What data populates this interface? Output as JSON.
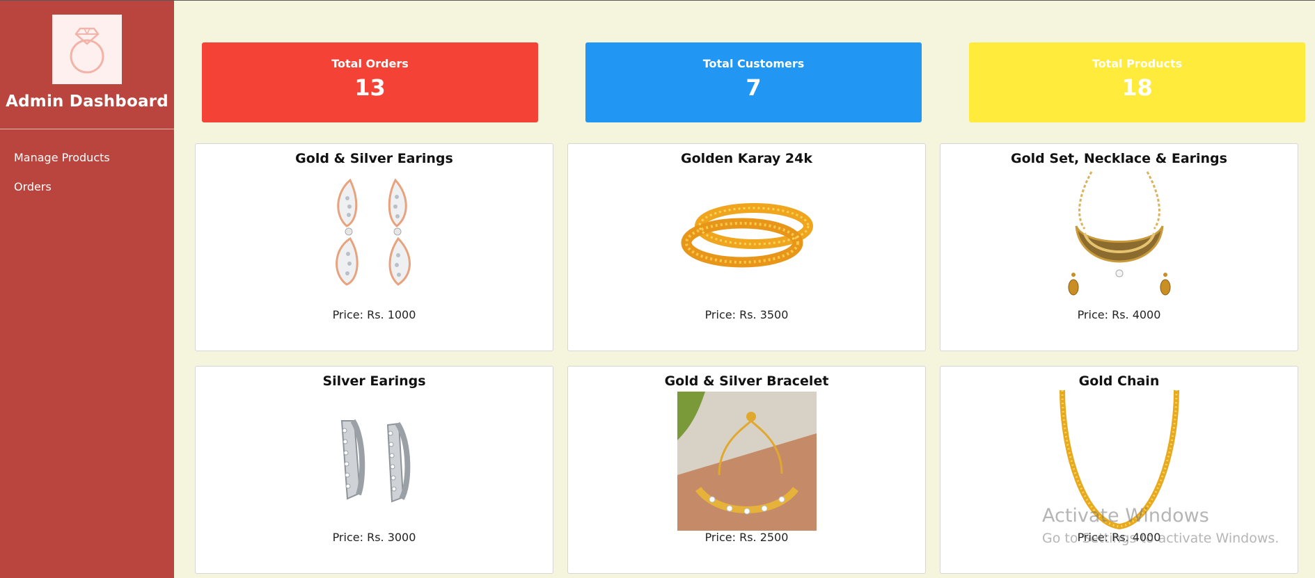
{
  "sidebar": {
    "logo_icon": "ring-icon",
    "title": "Admin Dashboard",
    "nav": [
      "Manage Products",
      "Orders"
    ]
  },
  "stats": [
    {
      "label": "Total Orders",
      "value": "13",
      "color": "#f44336"
    },
    {
      "label": "Total Customers",
      "value": "7",
      "color": "#2196f3"
    },
    {
      "label": "Total Products",
      "value": "18",
      "color": "#ffeb3b"
    }
  ],
  "products": [
    {
      "name": "Gold & Silver Earings",
      "price": "Price: Rs. 1000",
      "image": "earrings-image"
    },
    {
      "name": "Golden Karay 24k",
      "price": "Price: Rs. 3500",
      "image": "bangles-image"
    },
    {
      "name": "Gold Set, Necklace & Earings",
      "price": "Price: Rs. 4000",
      "image": "necklace-image"
    },
    {
      "name": "Silver Earings",
      "price": "Price: Rs. 3000",
      "image": "silver-earrings-image"
    },
    {
      "name": "Gold & Silver Bracelet",
      "price": "Price: Rs. 2500",
      "image": "bracelet-image"
    },
    {
      "name": "Gold Chain",
      "price": "Price: Rs. 4000",
      "image": "chain-image"
    }
  ],
  "watermark": {
    "line1": "Activate Windows",
    "line2": "Go to Settings to activate Windows."
  }
}
